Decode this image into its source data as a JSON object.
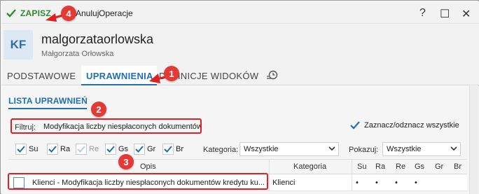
{
  "toolbar": {
    "save_label": "ZAPISZ",
    "cancel_label": "Anuluj",
    "operations_label": "Operacje"
  },
  "window_controls": {
    "help": "?",
    "maximize": "☐",
    "close": "✕"
  },
  "header": {
    "avatar_initials": "KF",
    "username": "malgorzataorlowska",
    "full_name": "Małgorzata Orłowska"
  },
  "tabs": [
    {
      "label": "PODSTAWOWE",
      "active": false
    },
    {
      "label": "UPRAWNIENIA",
      "active": true
    },
    {
      "label": "DEFINICJE WIDOKÓW",
      "active": false
    }
  ],
  "section_title": "LISTA UPRAWNIEŃ",
  "filter": {
    "label": "Filtruj:",
    "value": "Modyfikacja liczby niespłaconych dokumentów"
  },
  "select_all": {
    "label": "Zaznacz/odznacz wszystkie",
    "checked": true
  },
  "permission_filters": [
    {
      "label": "Su",
      "checked": true,
      "enabled": true
    },
    {
      "label": "Ra",
      "checked": true,
      "enabled": true
    },
    {
      "label": "Re",
      "checked": true,
      "enabled": false
    },
    {
      "label": "Gs",
      "checked": true,
      "enabled": true
    },
    {
      "label": "Gr",
      "checked": true,
      "enabled": true
    },
    {
      "label": "Br",
      "checked": true,
      "enabled": true
    }
  ],
  "category": {
    "label": "Kategoria:",
    "value": "Wszystkie"
  },
  "show": {
    "label": "Pokazuj:",
    "value": "Wszystkie"
  },
  "table": {
    "columns": [
      "Opis",
      "Kategoria",
      "Su",
      "Ra",
      "Re",
      "Gs",
      "Gr",
      "Br"
    ],
    "rows": [
      {
        "checked": false,
        "opis": "Klienci - Modyfikacja liczby niespłaconych dokumentów kredytu ku...",
        "kategoria": "Klienci",
        "su": "•",
        "ra": "•",
        "re": "•",
        "gs": "•",
        "gr": "",
        "br": ""
      }
    ]
  },
  "annotations": [
    "1",
    "2",
    "3",
    "4"
  ],
  "colors": {
    "accent": "#1f6fb2",
    "save_green": "#2e8b2e",
    "annotation_red": "#e02020"
  }
}
